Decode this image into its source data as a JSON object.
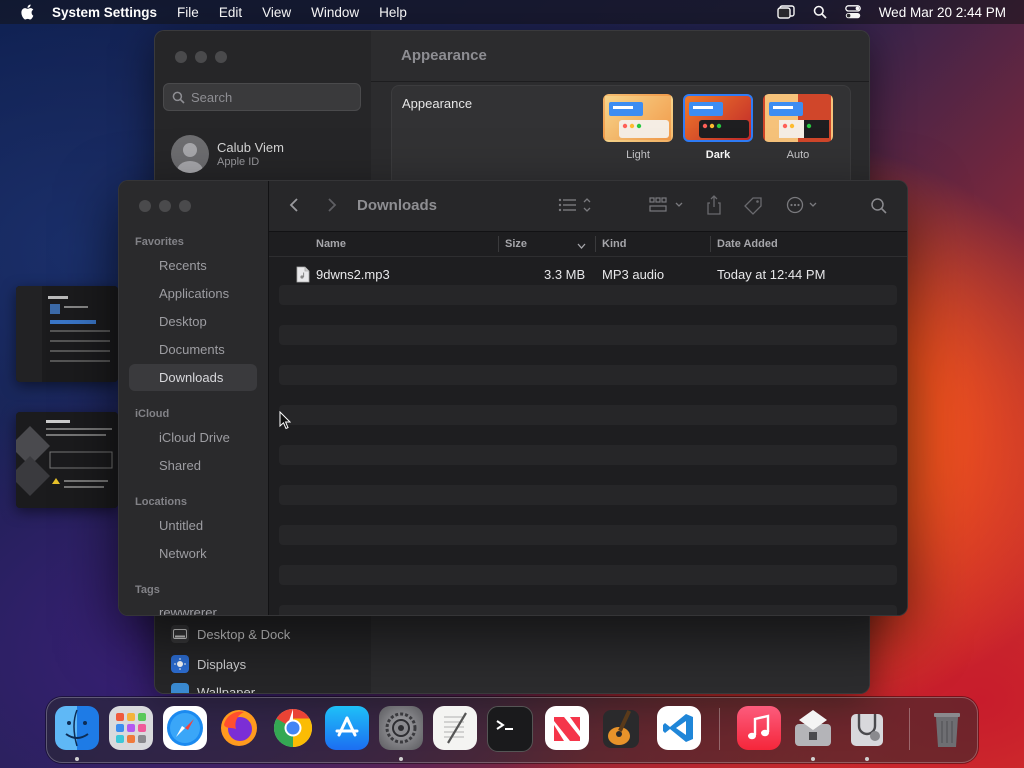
{
  "menubar": {
    "app_name": "System Settings",
    "menus": [
      "File",
      "Edit",
      "View",
      "Window",
      "Help"
    ],
    "datetime": "Wed Mar 20  2:44 PM"
  },
  "settings": {
    "search_placeholder": "Search",
    "user_name": "Calub Viem",
    "user_subtitle": "Apple ID",
    "page_title": "Appearance",
    "appearance_label": "Appearance",
    "options": [
      {
        "label": "Light",
        "selected": false
      },
      {
        "label": "Dark",
        "selected": true
      },
      {
        "label": "Auto",
        "selected": false
      }
    ],
    "lower_items": [
      "Desktop & Dock",
      "Displays",
      "Wallpaper"
    ]
  },
  "finder": {
    "title": "Downloads",
    "sidebar": {
      "favorites_header": "Favorites",
      "favorites": [
        "Recents",
        "Applications",
        "Desktop",
        "Documents",
        "Downloads"
      ],
      "selected": "Downloads",
      "icloud_header": "iCloud",
      "icloud": [
        "iCloud Drive",
        "Shared"
      ],
      "locations_header": "Locations",
      "locations": [
        "Untitled",
        "Network"
      ],
      "tags_header": "Tags",
      "tags": [
        "rewwrerer"
      ]
    },
    "columns": {
      "name": "Name",
      "size": "Size",
      "kind": "Kind",
      "date_added": "Date Added"
    },
    "files": [
      {
        "name": "9dwns2.mp3",
        "size": "3.3 MB",
        "kind": "MP3 audio",
        "date_added": "Today at 12:44 PM"
      }
    ]
  },
  "dock": {
    "apps": [
      "Finder",
      "Launchpad",
      "Safari",
      "Firefox",
      "Chrome",
      "App Store",
      "System Settings",
      "TextEdit",
      "Terminal",
      "News",
      "GarageBand",
      "Visual Studio Code",
      "Music",
      "Boot Camp Assistant",
      "Disk Utility",
      "Trash"
    ]
  },
  "colors": {
    "accent": "#2f7cf6",
    "window_bg": "#1e1e20"
  }
}
